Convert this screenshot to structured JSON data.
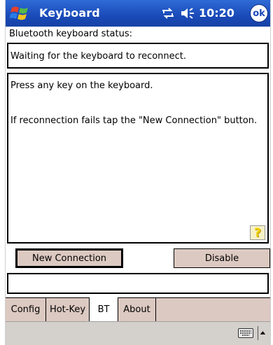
{
  "titlebar": {
    "start_icon": "windows-flag-icon",
    "title": "Keyboard",
    "connectivity_icon": "connectivity-icon",
    "volume_icon": "volume-icon",
    "time": "10:20",
    "ok_label": "ok"
  },
  "status": {
    "label": "Bluetooth keyboard status:",
    "value": "Waiting for the keyboard to reconnect."
  },
  "info": {
    "line1": "Press any key on the keyboard.",
    "line2": "If reconnection fails tap the \"New Connection\" button.",
    "help_label": "?"
  },
  "buttons": {
    "new_connection": "New Connection",
    "disable": "Disable"
  },
  "input": {
    "value": ""
  },
  "tabs": [
    {
      "label": "Config",
      "active": false
    },
    {
      "label": "Hot-Key",
      "active": false
    },
    {
      "label": "BT",
      "active": true
    },
    {
      "label": "About",
      "active": false
    }
  ],
  "commandbar": {
    "keyboard_icon": "keyboard-icon",
    "sip_arrow_icon": "up-arrow-icon"
  },
  "colors": {
    "titlebar": "#1a4ab8",
    "button_face": "#dcc9c1",
    "help_yellow": "#f3d100"
  }
}
